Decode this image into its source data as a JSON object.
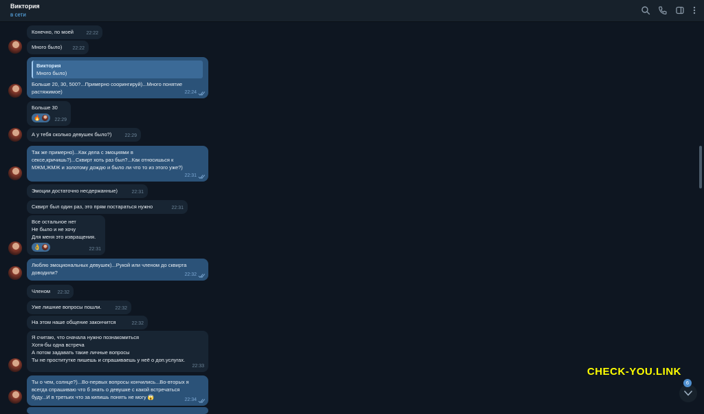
{
  "header": {
    "contact_name": "Виктория",
    "status": "в сети",
    "icons": [
      "search-icon",
      "phone-icon",
      "sidebar-icon",
      "more-icon"
    ]
  },
  "colors": {
    "background": "#0e1621",
    "incoming_bubble": "#182533",
    "outgoing_bubble": "#2b5278",
    "accent": "#5eb5f7",
    "watermark": "#ffff00"
  },
  "messages": [
    {
      "dir": "in",
      "lines": [
        "Конечно,  по моей"
      ],
      "time": "22:22"
    },
    {
      "dir": "in",
      "lines": [
        "Много было)"
      ],
      "time": "22:22"
    },
    {
      "dir": "out",
      "reply_to": {
        "name": "Виктория",
        "text": "Много было)"
      },
      "lines": [
        "Больше 20, 30, 500?...Примерно соорингируй)...Много понятие",
        "растяжимое)"
      ],
      "time": "22:24"
    },
    {
      "dir": "in",
      "lines": [
        "Больше 30"
      ],
      "reaction": "🔥",
      "time": "22:29"
    },
    {
      "dir": "in",
      "lines": [
        "А у тебя сколько девушек было?)"
      ],
      "time": "22:29"
    },
    {
      "dir": "out",
      "lines": [
        "Так же примерно)...Как дела с эмоциями в",
        "сексе,кричишь?)...Сквирт хоть раз был?...Как относишься к",
        "МЖМ,ЖМЖ и золотому дождю и было ли что то из этого уже?)"
      ],
      "time": "22:31"
    },
    {
      "dir": "in",
      "lines": [
        "Эмоции достаточно несдержанные)"
      ],
      "time": "22:31"
    },
    {
      "dir": "in",
      "lines": [
        "Сквирт был один раз,  это прям постараться нужно"
      ],
      "time": "22:31"
    },
    {
      "dir": "in",
      "lines": [
        "Все остальное нет",
        "Не было и не хочу",
        "Для меня это извращения."
      ],
      "reaction": "👌",
      "time": "22:31"
    },
    {
      "dir": "out",
      "lines": [
        "Люблю эмоциональных девушек)...Рукой или членом до сквирта",
        "доводили?"
      ],
      "time": "22:32"
    },
    {
      "dir": "in",
      "lines": [
        "Членом"
      ],
      "time": "22:32"
    },
    {
      "dir": "in",
      "lines": [
        "Уже лишние вопросы пошли."
      ],
      "time": "22:32"
    },
    {
      "dir": "in",
      "lines": [
        "На этом наше общение закончится"
      ],
      "time": "22:32"
    },
    {
      "dir": "in",
      "lines": [
        "Я считаю, что сначала нужно познакомиться",
        "Хотя-бы одна встреча",
        "А потом задавать такие личные вопросы",
        "Ты не проститутке пишешь и спрашиваешь у неё о доп.услугах."
      ],
      "time": "22:33"
    },
    {
      "dir": "out",
      "lines": [
        "Ты о чем, солнце?)...Во-первых вопросы кончились...Во-вторых я",
        "всегда спрашиваю что б знать о девушке с какой встречаться",
        "буду...И в третьих что за кипишь понять не могу 😱"
      ],
      "time": "22:34"
    }
  ],
  "watermark": "CHECK-YOU.LINK",
  "scroll_down": {
    "unread_count": "6"
  }
}
